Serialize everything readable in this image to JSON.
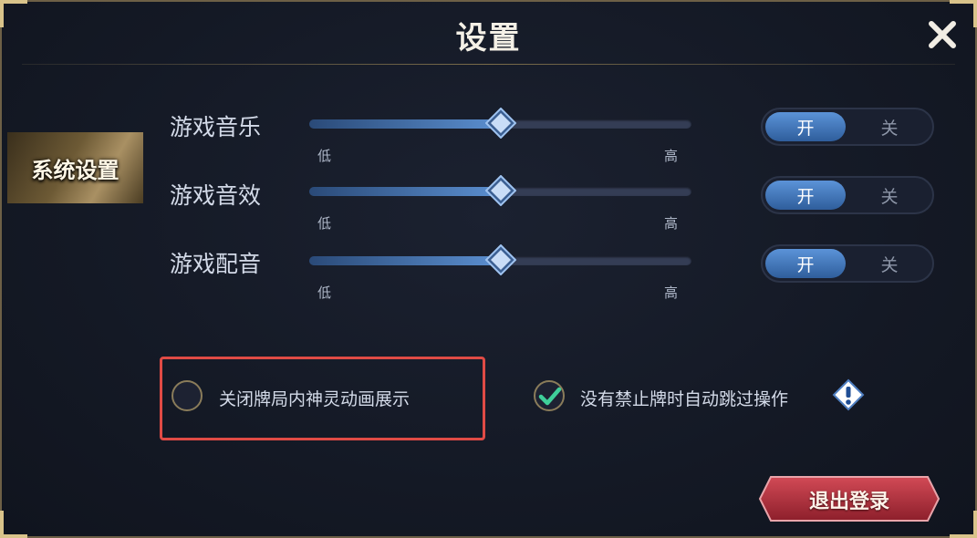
{
  "dialog": {
    "title": "设置"
  },
  "sidebar": {
    "tab_label": "系统设置"
  },
  "settings": [
    {
      "label": "游戏音乐",
      "low": "低",
      "high": "高",
      "level": 0.5,
      "on_label": "开",
      "off_label": "关",
      "enabled": true
    },
    {
      "label": "游戏音效",
      "low": "低",
      "high": "高",
      "level": 0.5,
      "on_label": "开",
      "off_label": "关",
      "enabled": true
    },
    {
      "label": "游戏配音",
      "low": "低",
      "high": "高",
      "level": 0.5,
      "on_label": "开",
      "off_label": "关",
      "enabled": true
    }
  ],
  "options": {
    "hide_animation_label": "关闭牌局内神灵动画展示",
    "hide_animation_checked": false,
    "auto_skip_label": "没有禁止牌时自动跳过操作",
    "auto_skip_checked": true
  },
  "footer": {
    "logout_label": "退出登录"
  },
  "colors": {
    "accent_blue": "#5b93d8",
    "gold": "#d9c38a",
    "danger": "#b8323d",
    "highlight": "#e04b45",
    "check_green": "#3fcf9a"
  }
}
